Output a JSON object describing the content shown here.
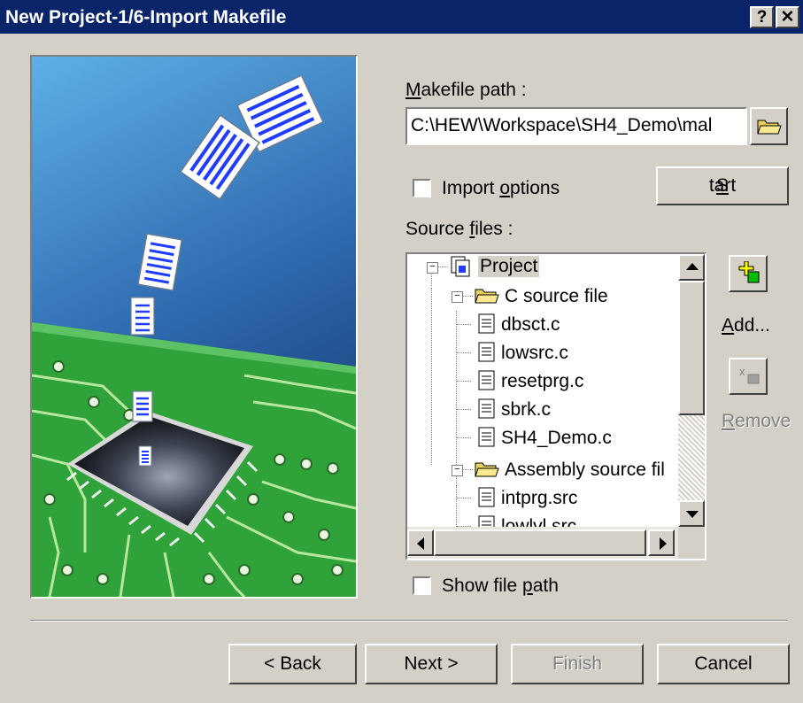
{
  "window": {
    "title": "New Project-1/6-Import Makefile",
    "help_label": "?",
    "close_label": "✕"
  },
  "makefile": {
    "label_hotkey": "M",
    "label_rest": "akefile path :",
    "path_value": "C:\\HEW\\Workspace\\SH4_Demo\\mal",
    "browse_icon": "folder-open-icon"
  },
  "import_options": {
    "label_pre": "Import ",
    "label_hotkey": "o",
    "label_post": "ptions",
    "checked": false
  },
  "start_button": {
    "hotkey": "S",
    "rest": "tart"
  },
  "source_files": {
    "label_pre": "Source ",
    "label_hotkey": "f",
    "label_post": "iles :",
    "tree": [
      {
        "label": "Project",
        "level": 0,
        "kind": "project",
        "expanded": true,
        "selected": true
      },
      {
        "label": "C source file",
        "level": 1,
        "kind": "folder",
        "expanded": true
      },
      {
        "label": "dbsct.c",
        "level": 2,
        "kind": "file"
      },
      {
        "label": "lowsrc.c",
        "level": 2,
        "kind": "file"
      },
      {
        "label": "resetprg.c",
        "level": 2,
        "kind": "file"
      },
      {
        "label": "sbrk.c",
        "level": 2,
        "kind": "file"
      },
      {
        "label": "SH4_Demo.c",
        "level": 2,
        "kind": "file"
      },
      {
        "label": "Assembly source fil",
        "level": 1,
        "kind": "folder",
        "expanded": true
      },
      {
        "label": "intprg.src",
        "level": 2,
        "kind": "file"
      },
      {
        "label": "lowlvl.src",
        "level": 2,
        "kind": "file"
      }
    ]
  },
  "add_button": {
    "hotkey": "A",
    "rest": "dd...",
    "icon": "add-file-icon"
  },
  "remove_button": {
    "hotkey": "R",
    "rest": "emove",
    "icon": "remove-file-icon",
    "enabled": false
  },
  "show_file_path": {
    "label_pre": "Show file ",
    "label_hotkey": "p",
    "label_post": "ath",
    "checked": false
  },
  "footer": {
    "back_label": "< Back",
    "next_label": "Next >",
    "finish_label": "Finish",
    "cancel_label": "Cancel",
    "finish_enabled": false
  },
  "colors": {
    "titlebar": "#0a246a",
    "dialog_bg": "#d4d0c8",
    "art_sky_top": "#4f9ad6",
    "art_sky_bottom": "#1a3f78",
    "art_board": "#2fa33a"
  }
}
